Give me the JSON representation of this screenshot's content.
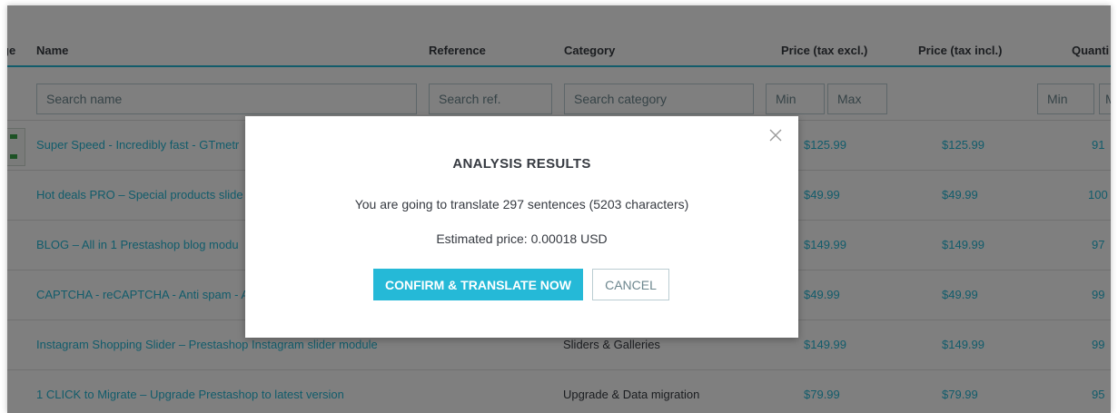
{
  "table": {
    "columns": {
      "image": "ge",
      "name": "Name",
      "reference": "Reference",
      "category": "Category",
      "price_excl": "Price (tax excl.)",
      "price_incl": "Price (tax incl.)",
      "quantity": "Quanti"
    },
    "filters": {
      "name_placeholder": "Search name",
      "ref_placeholder": "Search ref.",
      "category_placeholder": "Search category",
      "price_min": "Min",
      "price_max": "Max",
      "qty_min": "Min",
      "qty_max": "M"
    },
    "rows": [
      {
        "name": "Super Speed - Incredibly fast - GTmetr",
        "category": "",
        "price_excl": "$125.99",
        "price_incl": "$125.99",
        "quantity": "91"
      },
      {
        "name": "Hot deals PRO – Special products slide",
        "category": "",
        "price_excl": "$49.99",
        "price_incl": "$49.99",
        "quantity": "100"
      },
      {
        "name": "BLOG – All in 1 Prestashop blog modu",
        "category": "",
        "price_excl": "$149.99",
        "price_incl": "$149.99",
        "quantity": "97"
      },
      {
        "name": "CAPTCHA - reCAPTCHA - Anti spam - A",
        "category": "",
        "price_excl": "$49.99",
        "price_incl": "$49.99",
        "quantity": "99"
      },
      {
        "name": "Instagram Shopping Slider – Prestashop Instagram slider module",
        "category": "Sliders & Galleries",
        "price_excl": "$149.99",
        "price_incl": "$149.99",
        "quantity": "99"
      },
      {
        "name": "1 CLICK to Migrate – Upgrade Prestashop to latest version",
        "category": "Upgrade & Data migration",
        "price_excl": "$79.99",
        "price_incl": "$79.99",
        "quantity": "95"
      }
    ]
  },
  "modal": {
    "title": "ANALYSIS RESULTS",
    "message": "You are going to translate 297 sentences (5203 characters)",
    "estimate": "Estimated price: 0.00018 USD",
    "confirm_label": "CONFIRM & TRANSLATE NOW",
    "cancel_label": "CANCEL",
    "close_icon": "close-icon"
  },
  "colors": {
    "accent": "#25b9d7",
    "text": "#363a41",
    "overlay": "rgba(0,0,0,0.5)"
  }
}
